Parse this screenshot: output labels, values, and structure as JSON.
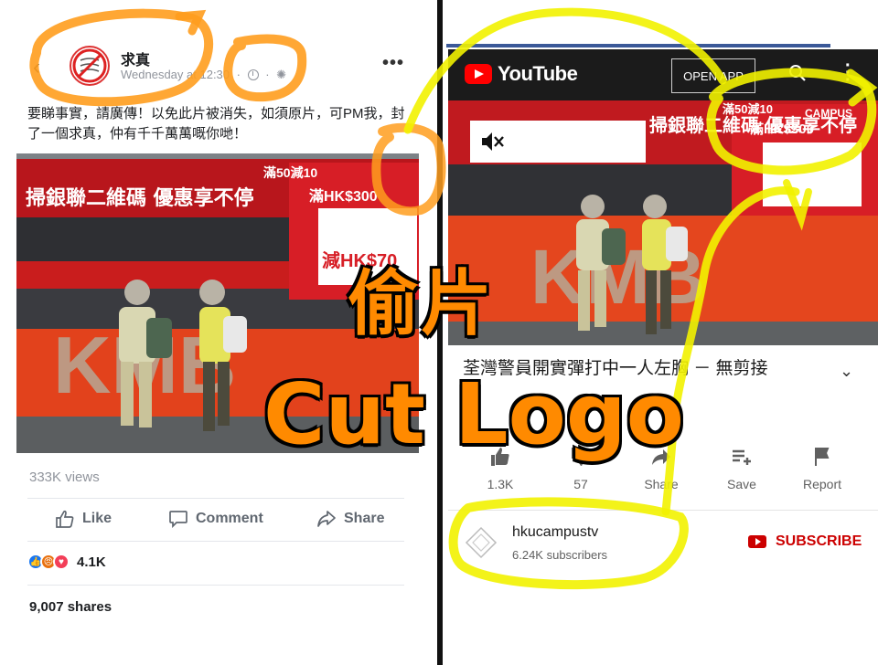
{
  "facebook_post": {
    "page_name": "求真",
    "timestamp": "Wednesday at 12:30",
    "caption": "要睇事實，請廣傳！以免此片被消失，如須原片，可PM我，封了一個求真，仲有千千萬萬嘅你哋！",
    "video": {
      "bus_text_1": "掃銀聯二維碼  優惠享不停",
      "bus_text_2": "滿HK$300",
      "bus_text_3": "減HK$70",
      "bus_text_4": "滿50減10",
      "bus_brand": "KMB"
    },
    "views": "333K views",
    "actions": {
      "like": "Like",
      "comment": "Comment",
      "share": "Share"
    },
    "reaction_count": "4.1K",
    "shares": "9,007 shares",
    "colors": {
      "like_blue": "#1877f2",
      "angry_orange": "#e9710f",
      "love_red": "#f33e58"
    }
  },
  "youtube": {
    "logo_text": "YouTube",
    "open_app": "OPEN APP",
    "video": {
      "watermark": "CAMPUS",
      "bus_text_1": "掃銀聯二維碼  優惠享不停",
      "bus_text_2": "滿HK$300",
      "bus_text_4": "滿50減10",
      "bus_brand": "KMB"
    },
    "title": "荃灣警員開實彈打中一人左胸 － 無剪接",
    "actions": [
      {
        "icon": "like-icon",
        "label": "1.3K"
      },
      {
        "icon": "dislike-icon",
        "label": "57"
      },
      {
        "icon": "share-icon",
        "label": "Share"
      },
      {
        "icon": "save-icon",
        "label": "Save"
      },
      {
        "icon": "report-icon",
        "label": "Report"
      }
    ],
    "channel": {
      "name": "hkucampustv",
      "subscribers": "6.24K subscribers"
    },
    "subscribe": "SUBSCRIBE",
    "colors": {
      "brand_red": "#ff0000",
      "subscribe_red": "#cc0000"
    }
  },
  "overlay": {
    "line1": "偷片",
    "line2": "Cut Logo"
  },
  "annotation_colors": {
    "orange": "#ff9d1e",
    "yellow": "#f2f200"
  }
}
